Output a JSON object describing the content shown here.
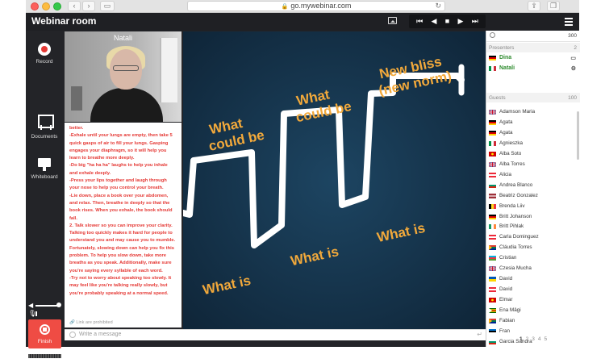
{
  "browser": {
    "url": "go.mywebinar.com"
  },
  "app": {
    "title": "Webinar room"
  },
  "tools": {
    "record": "Record",
    "documents": "Documents",
    "whiteboard": "Whiteboard",
    "finish": "Finish"
  },
  "video": {
    "name": "Natali"
  },
  "chat": {
    "text": "better.\n-Exhale until your lungs are empty, then take 5 quick gasps of air to fill your lungs. Gasping engages your diaphragm, so it will help you learn to breathe more deeply.\n-Do big \"ha ha ha\" laughs to help you inhale and exhale deeply.\n-Press your lips together and laugh through your nose to help you control your breath.\n-Lie down, place a book over your abdomen, and relax. Then, breathe in deeply so that the book rises. When you exhale, the book should fall.\n2. Talk slower so you can improve your clarity. Talking too quickly makes it hard for people to understand you and may cause you to mumble. Fortunately, slowing down can help you fix this problem. To help you slow down, take more breaths as you speak. Additionally, make sure you're saying every syllable of each word.\n-Try not to worry about speaking too slowly. It may feel like you're talking really slowly, but you're probably speaking at a normal speed.",
    "link_note": "Link are prohibited",
    "placeholder": "Write a message"
  },
  "slide": {
    "labels": [
      "What could be",
      "What could be",
      "New bliss (new norm)",
      "What is",
      "What is",
      "What is"
    ]
  },
  "participants": {
    "search_count": "300",
    "presenters_label": "Presenters",
    "presenters_count": "2",
    "presenters": [
      {
        "name": "Dina",
        "icon": "monitor-icon"
      },
      {
        "name": "Natali",
        "icon": "gear-icon"
      }
    ],
    "guests_label": "Guests",
    "guests_count": "100",
    "guests": [
      {
        "name": "Adamson Maria",
        "flag": "gb"
      },
      {
        "name": "Agata",
        "flag": "de"
      },
      {
        "name": "Agata",
        "flag": "de"
      },
      {
        "name": "Agnieszka",
        "flag": "it"
      },
      {
        "name": "Alba Soto",
        "flag": "mk"
      },
      {
        "name": "Alba Torres",
        "flag": "gb"
      },
      {
        "name": "Alicia",
        "flag": "at"
      },
      {
        "name": "Andrea Blanco",
        "flag": "bg"
      },
      {
        "name": "Beatriz Gonzalez",
        "flag": "lv"
      },
      {
        "name": "Brenda Liiv",
        "flag": "be"
      },
      {
        "name": "Britt Johanson",
        "flag": "de"
      },
      {
        "name": "Britt Pihlak",
        "flag": "ie"
      },
      {
        "name": "Carla Dominguez",
        "flag": "at"
      },
      {
        "name": "Cláudia Torres",
        "flag": "za"
      },
      {
        "name": "Cristian",
        "flag": "az"
      },
      {
        "name": "Czesia Mucha",
        "flag": "gb"
      },
      {
        "name": "David",
        "flag": "ua"
      },
      {
        "name": "David",
        "flag": "at"
      },
      {
        "name": "Elmar",
        "flag": "mk"
      },
      {
        "name": "Ena Mägi",
        "flag": "zw"
      },
      {
        "name": "Fabian",
        "flag": "za"
      },
      {
        "name": "Fran",
        "flag": "ee"
      },
      {
        "name": "Garcia Sandra",
        "flag": "bg"
      }
    ],
    "pages": [
      "1",
      "2",
      "3",
      "4",
      "5"
    ]
  },
  "colors": {
    "accent_red": "#ef4c44",
    "presenter_green": "#2e8b2e",
    "slide_bg": "#16324a",
    "slide_label": "#f2a93b"
  }
}
